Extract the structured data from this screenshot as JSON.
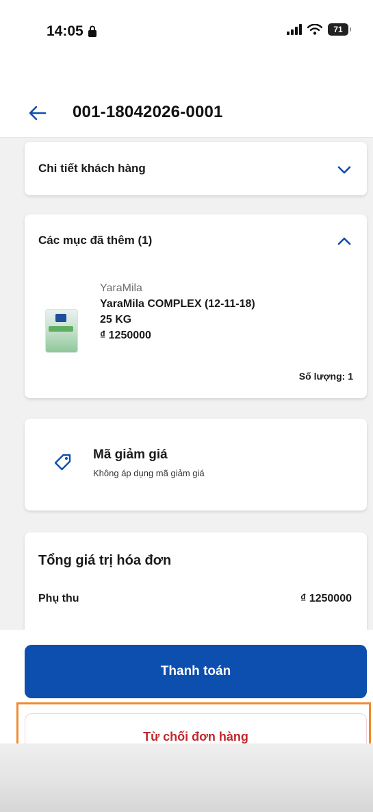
{
  "status_bar": {
    "time": "14:05",
    "battery": "71",
    "icons": [
      "lock-icon",
      "signal-icon",
      "wifi-icon",
      "battery-icon"
    ]
  },
  "header": {
    "title": "001-18042026-0001",
    "back_icon": "arrow-left-icon"
  },
  "customer_section": {
    "title": "Chi tiết khách hàng",
    "expanded": false
  },
  "items_section": {
    "title": "Các mục đã thêm (1)",
    "expanded": true,
    "items": [
      {
        "brand": "YaraMila",
        "name": "YaraMila COMPLEX (12-11-18)",
        "weight": "25 KG",
        "price": "₫ 1250000",
        "quantity": "Số lượng: 1"
      }
    ]
  },
  "discount_section": {
    "title": "Mã giảm giá",
    "subtitle": "Không áp dụng mã giảm giá",
    "icon": "tag-icon"
  },
  "total_section": {
    "title": "Tổng giá trị hóa đơn",
    "rows": [
      {
        "label": "Phụ thu",
        "value": "₫ 1250000"
      }
    ]
  },
  "actions": {
    "pay_label": "Thanh toán",
    "reject_label": "Từ chối đơn hàng"
  },
  "colors": {
    "primary": "#0d4fae",
    "danger": "#c1272d",
    "highlight": "#f08a2e",
    "background": "#f1f1f1"
  }
}
